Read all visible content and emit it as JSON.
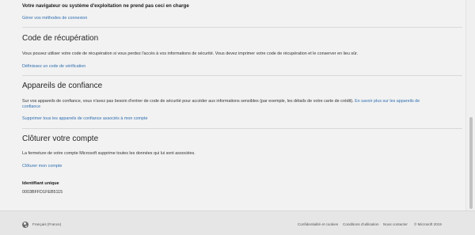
{
  "browser_section": {
    "title": "Votre navigateur ou système d'exploitation ne prend pas ceci en charge",
    "link": "Gérer vos méthodes de connexion"
  },
  "recovery_code": {
    "heading": "Code de récupération",
    "body": "Vous pouvez utiliser votre code de récupération si vous perdez l'accès à vos informations de sécurité. Vous devez imprimer votre code de récupération et le conserver en lieu sûr.",
    "link": "Définissez un code de vérification"
  },
  "trusted_devices": {
    "heading": "Appareils de confiance",
    "body_line1": "Sur vos appareils de confiance, vous n'avez pas besoin d'entrer de code de sécurité pour accéder aux informations sensibles (par exemple, les détails de votre carte de crédit).",
    "learn_more_link": "En savoir plus sur les appareils de",
    "learn_more_link_cont": "confiance",
    "remove_link": "Supprimer tous les appareils de confiance associés à mon compte"
  },
  "close_account": {
    "heading": "Clôturer votre compte",
    "body": "La fermeture de votre compte Microsoft supprime toutes les données qui lui sont associées.",
    "link": "Clôturer mon compte"
  },
  "unique_id": {
    "label": "Identifiant unique",
    "value": "0003BFFD1FEB5115"
  },
  "footer": {
    "language": "Français (France)",
    "links": [
      "Confidentialité et cookies",
      "Conditions d'utilisation",
      "Nous contacter"
    ],
    "copyright": "© Microsoft 2019"
  },
  "colors": {
    "link": "#2f6eb0",
    "background": "#f2f2f2",
    "footer": "#e6e6e6"
  }
}
